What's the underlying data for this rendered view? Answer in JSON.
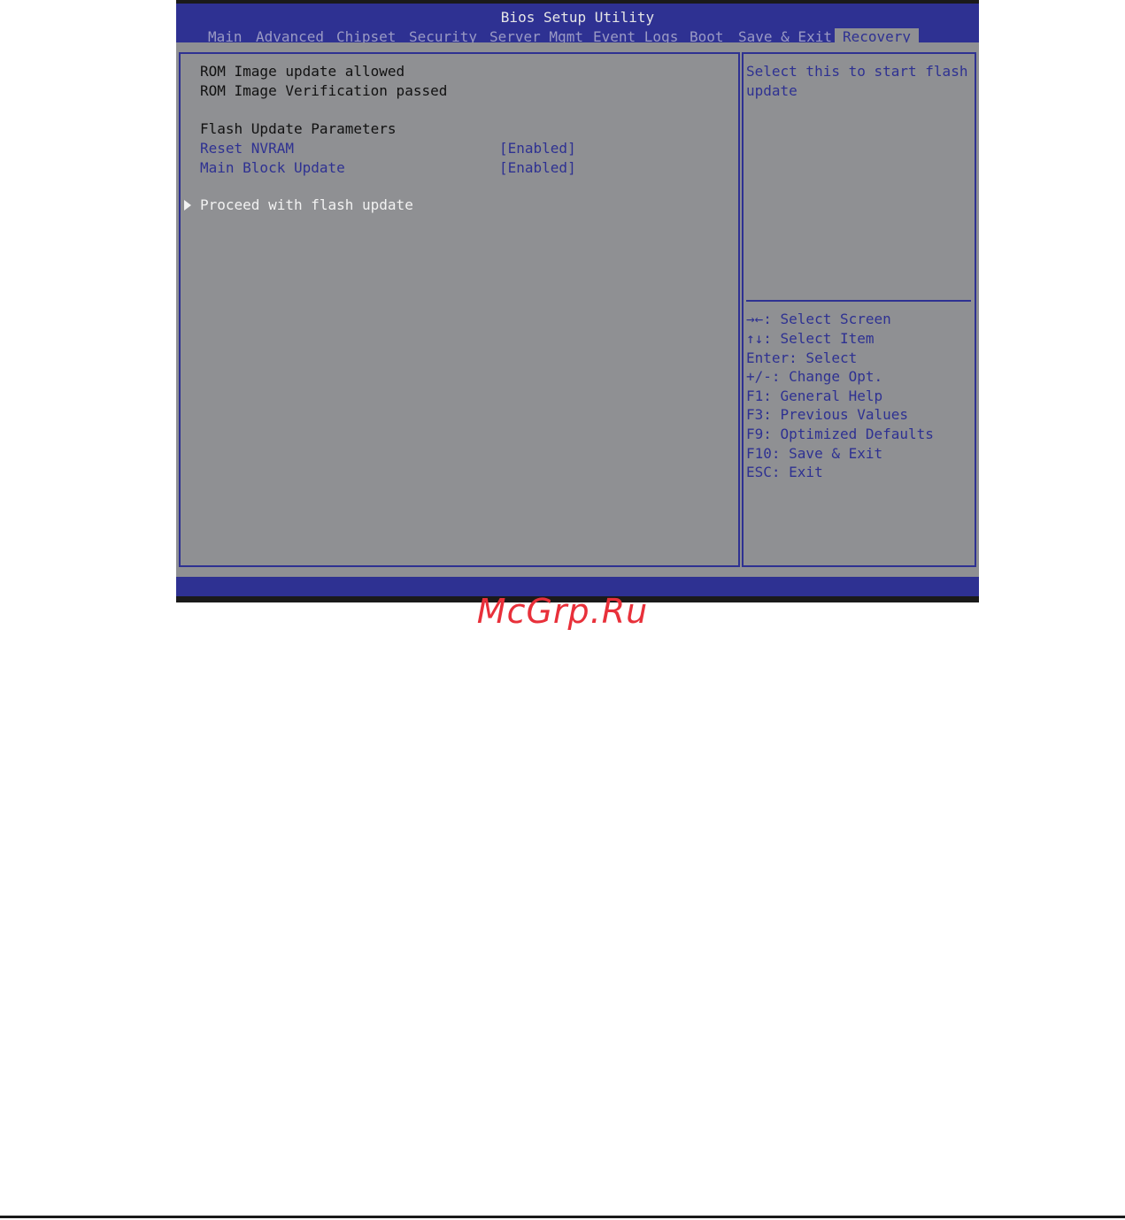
{
  "window": {
    "title": "Bios Setup Utility"
  },
  "tabs": [
    {
      "label": "Main"
    },
    {
      "label": "Advanced"
    },
    {
      "label": "Chipset"
    },
    {
      "label": "Security"
    },
    {
      "label": "Server Mgmt"
    },
    {
      "label": "Event Logs"
    },
    {
      "label": "Boot"
    },
    {
      "label": "Save & Exit"
    },
    {
      "label": "Recovery",
      "active": true
    }
  ],
  "main": {
    "status_lines": [
      "ROM Image update allowed",
      "ROM Image Verification passed"
    ],
    "section_title": "Flash Update Parameters",
    "settings": [
      {
        "label": "Reset NVRAM",
        "value": "[Enabled]"
      },
      {
        "label": "Main Block Update",
        "value": "[Enabled]"
      }
    ],
    "action": {
      "label": "Proceed with flash update"
    }
  },
  "help": {
    "lines": [
      "Select this to start flash",
      "update"
    ]
  },
  "keys": [
    "→←: Select Screen",
    "↑↓: Select Item",
    "Enter: Select",
    "+/-: Change Opt.",
    "F1: General Help",
    "F3: Previous Values",
    "F9: Optimized Defaults",
    "F10: Save & Exit",
    "ESC: Exit"
  ],
  "colors": {
    "bios_blue": "#2e3192",
    "panel_gray": "#8f9093",
    "watermark_red": "#e8303a"
  },
  "watermark": {
    "text": "McGrp.Ru"
  }
}
